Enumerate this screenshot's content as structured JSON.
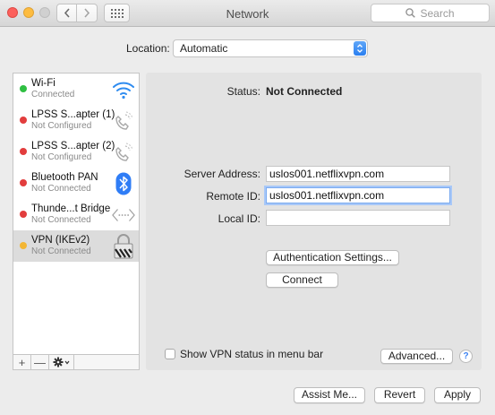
{
  "window": {
    "title": "Network"
  },
  "toolbar": {
    "search_placeholder": "Search"
  },
  "location": {
    "label": "Location:",
    "value": "Automatic"
  },
  "services": [
    {
      "name": "Wi-Fi",
      "status": "Connected",
      "dot": "green",
      "icon": "wifi-icon"
    },
    {
      "name": "LPSS S...apter (1)",
      "status": "Not Configured",
      "dot": "red",
      "icon": "phone-icon"
    },
    {
      "name": "LPSS S...apter (2)",
      "status": "Not Configured",
      "dot": "red",
      "icon": "phone-icon"
    },
    {
      "name": "Bluetooth PAN",
      "status": "Not Connected",
      "dot": "red",
      "icon": "bluetooth-icon"
    },
    {
      "name": "Thunde...t Bridge",
      "status": "Not Connected",
      "dot": "red",
      "icon": "thunderbolt-bridge-icon"
    },
    {
      "name": "VPN (IKEv2)",
      "status": "Not Connected",
      "dot": "yellow",
      "icon": "vpn-lock-icon"
    }
  ],
  "list_controls": {
    "add": "+",
    "remove": "—"
  },
  "detail": {
    "status_label": "Status:",
    "status_value": "Not Connected",
    "server_address_label": "Server Address:",
    "server_address_value": "uslos001.netflixvpn.com",
    "remote_id_label": "Remote ID:",
    "remote_id_value": "uslos001.netflixvpn.com",
    "local_id_label": "Local ID:",
    "local_id_value": "",
    "auth_button": "Authentication Settings...",
    "connect_button": "Connect",
    "show_status_label": "Show VPN status in menu bar",
    "show_status_checked": false,
    "advanced_button": "Advanced...",
    "help_symbol": "?"
  },
  "footer": {
    "assist": "Assist Me...",
    "revert": "Revert",
    "apply": "Apply"
  },
  "colors": {
    "accent": "#3b82f2",
    "wifi": "#2f8cf0",
    "bluetooth": "#2f7df6"
  }
}
